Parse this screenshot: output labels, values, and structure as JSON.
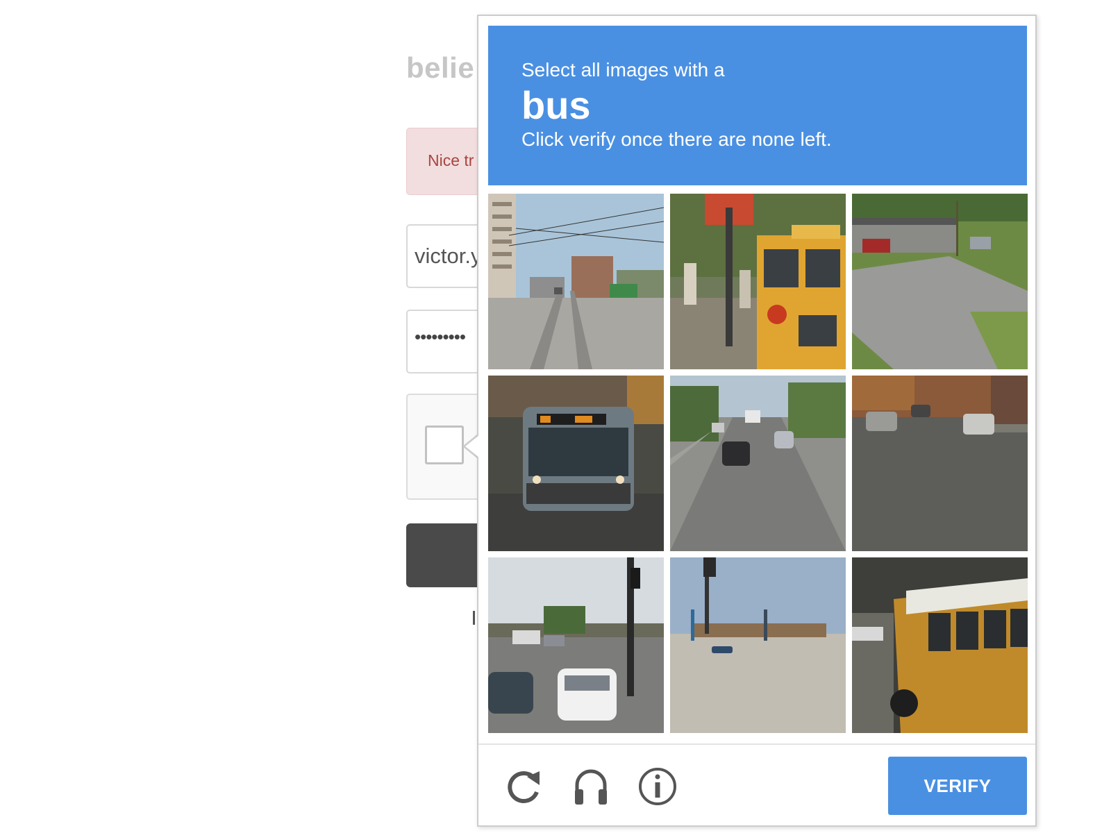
{
  "login": {
    "brand_partial": "belie",
    "alert_partial": "Nice tr",
    "username_partial": "victor.y",
    "password_mask": "•••••••••"
  },
  "captcha": {
    "instruction_line1": "Select all images with a",
    "keyword": "bus",
    "instruction_line3": "Click verify once there are none left.",
    "tiles": [
      {
        "description": "street with tram tracks and overhead wires"
      },
      {
        "description": "yellow school bus rear with pedestrians"
      },
      {
        "description": "driveway with carport and parked cars"
      },
      {
        "description": "city transit bus front on street"
      },
      {
        "description": "road with cars and trees"
      },
      {
        "description": "residential street with parked cars"
      },
      {
        "description": "intersection with white sedan and traffic lights"
      },
      {
        "description": "open parking lot with traffic signal"
      },
      {
        "description": "yellow school bus side view"
      }
    ],
    "footer": {
      "reload_icon": "reload-icon",
      "audio_icon": "headphones-icon",
      "info_icon": "info-icon",
      "verify_label": "VERIFY"
    },
    "colors": {
      "header_blue": "#4a90e2",
      "verify_blue": "#4a90e2",
      "icon_gray": "#555555"
    }
  }
}
